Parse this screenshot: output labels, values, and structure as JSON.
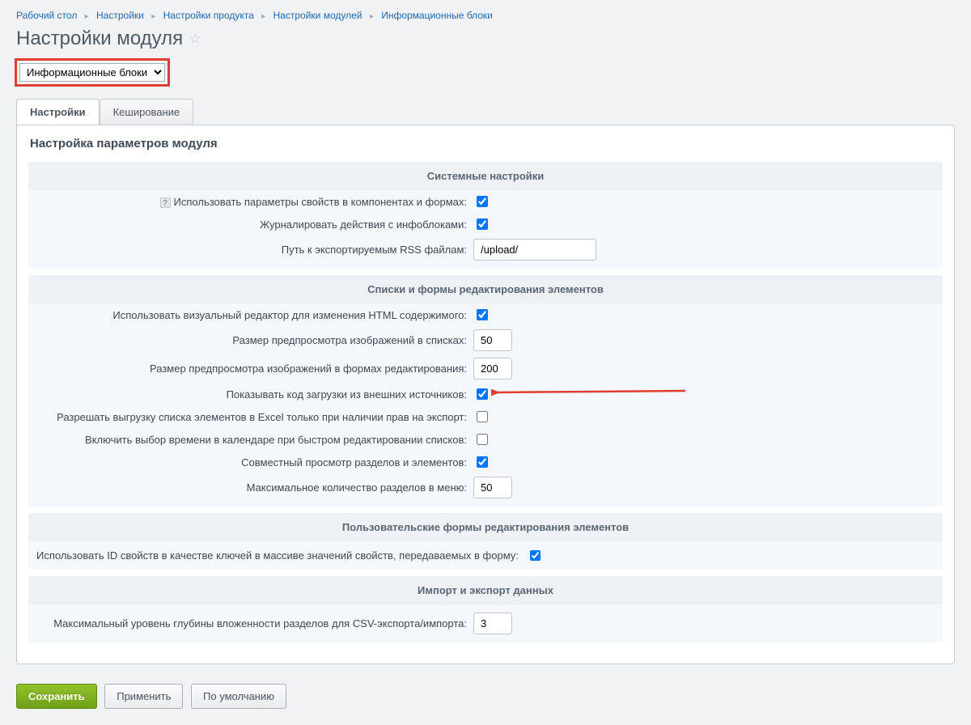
{
  "breadcrumb": [
    {
      "label": "Рабочий стол"
    },
    {
      "label": "Настройки"
    },
    {
      "label": "Настройки продукта"
    },
    {
      "label": "Настройки модулей"
    },
    {
      "label": "Информационные блоки"
    }
  ],
  "pageTitle": "Настройки модуля",
  "moduleSelect": {
    "value": "Информационные блоки"
  },
  "tabs": {
    "settings": "Настройки",
    "caching": "Кеширование"
  },
  "panelTitle": "Настройка параметров модуля",
  "sections": {
    "sys": {
      "title": "Системные настройки",
      "rows": {
        "useProps": {
          "label": "Использовать параметры свойств в компонентах и формах:",
          "checked": true,
          "help": true
        },
        "log": {
          "label": "Журналировать действия с инфоблоками:",
          "checked": true
        },
        "rssPath": {
          "label": "Путь к экспортируемым RSS файлам:",
          "value": "/upload/"
        }
      }
    },
    "lists": {
      "title": "Списки и формы редактирования элементов",
      "rows": {
        "visualEditor": {
          "label": "Использовать визуальный редактор для изменения HTML содержимого:",
          "checked": true
        },
        "previewList": {
          "label": "Размер предпросмотра изображений в списках:",
          "value": "50"
        },
        "previewForm": {
          "label": "Размер предпросмотра изображений в формах редактирования:",
          "value": "200"
        },
        "extCode": {
          "label": "Показывать код загрузки из внешних источников:",
          "checked": true
        },
        "excel": {
          "label": "Разрешать выгрузку списка элементов в Excel только при наличии прав на экспорт:",
          "checked": false
        },
        "calTime": {
          "label": "Включить выбор времени в календаре при быстром редактировании списков:",
          "checked": false
        },
        "combined": {
          "label": "Совместный просмотр разделов и элементов:",
          "checked": true
        },
        "maxSections": {
          "label": "Максимальное количество разделов в меню:",
          "value": "50"
        }
      }
    },
    "userForms": {
      "title": "Пользовательские формы редактирования элементов",
      "rows": {
        "idKeys": {
          "label": "Использовать ID свойств в качестве ключей в массиве значений свойств, передаваемых в форму:",
          "checked": true
        }
      }
    },
    "import": {
      "title": "Импорт и экспорт данных",
      "rows": {
        "csvDepth": {
          "label": "Максимальный уровень глубины вложенности разделов для CSV-экспорта/импорта:",
          "value": "3"
        }
      }
    }
  },
  "buttons": {
    "save": "Сохранить",
    "apply": "Применить",
    "default": "По умолчанию"
  }
}
